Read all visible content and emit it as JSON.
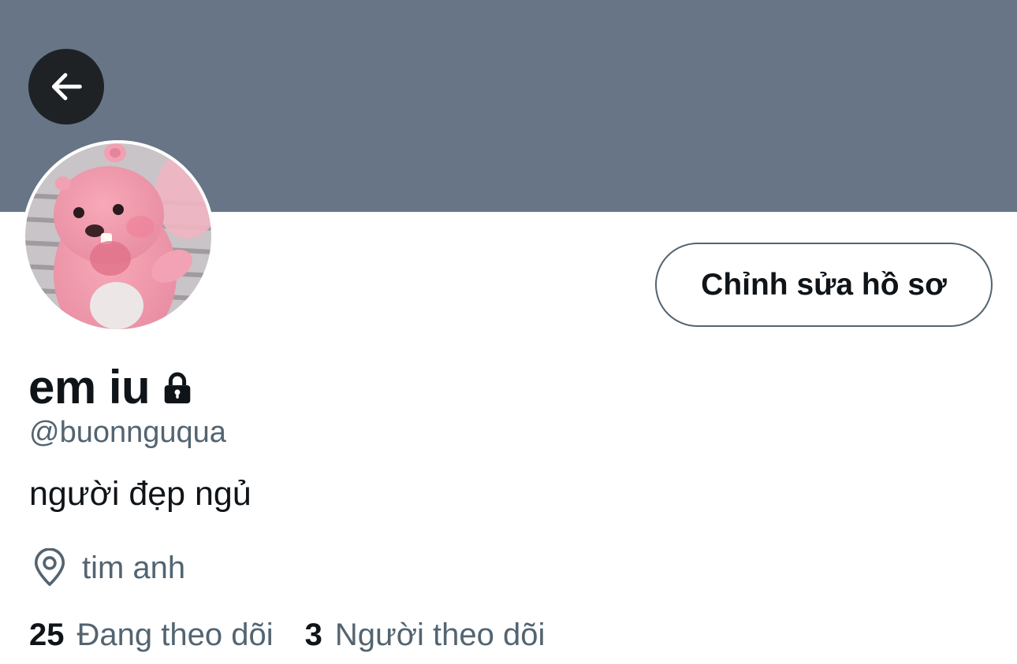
{
  "banner": {
    "color": "#677586"
  },
  "back_button": {
    "icon": "arrow-left-icon"
  },
  "profile": {
    "display_name": "em iu",
    "protected_icon": "lock-icon",
    "handle": "@buonnguqua",
    "bio": "người đẹp ngủ",
    "location": {
      "icon": "location-pin-icon",
      "text": "tim anh"
    },
    "edit_button_label": "Chỉnh sửa hồ sơ",
    "avatar": "pink beaver toy photo"
  },
  "stats": {
    "following": {
      "count": "25",
      "label": "Đang theo dõi"
    },
    "followers": {
      "count": "3",
      "label": "Người theo dõi"
    }
  },
  "colors": {
    "text_primary": "#0f1419",
    "text_secondary": "#536471",
    "back_button_bg": "#1e2225"
  }
}
